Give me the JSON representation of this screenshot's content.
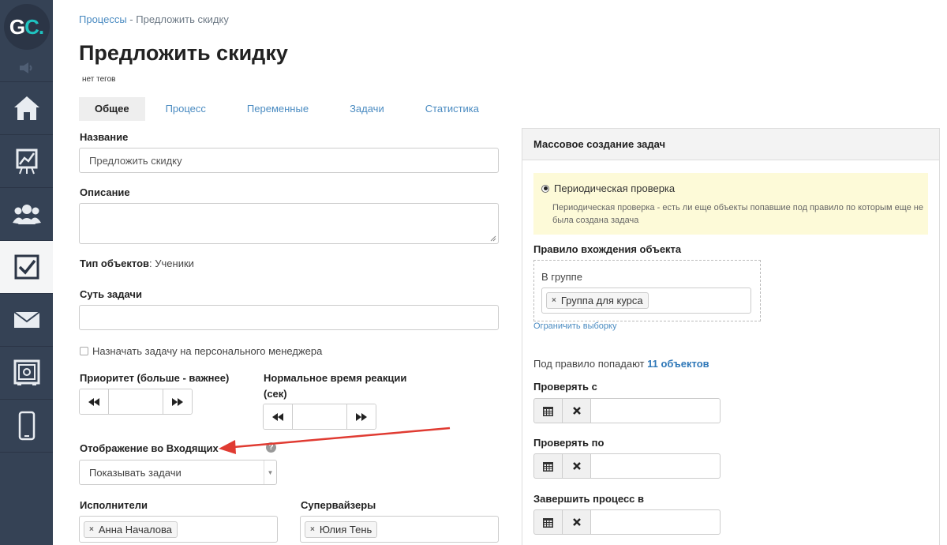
{
  "sidebar": {
    "logo": {
      "g": "G",
      "c": "C",
      "dot": "."
    },
    "items": [
      {
        "name": "home",
        "icon": "home-icon"
      },
      {
        "name": "stats",
        "icon": "chart-icon"
      },
      {
        "name": "users",
        "icon": "users-icon"
      },
      {
        "name": "tasks",
        "icon": "checkbox-icon",
        "active": true
      },
      {
        "name": "mail",
        "icon": "mail-icon"
      },
      {
        "name": "safe",
        "icon": "safe-icon"
      },
      {
        "name": "mobile",
        "icon": "phone-icon"
      }
    ]
  },
  "breadcrumb": {
    "root": "Процессы",
    "separator": " - ",
    "current": "Предложить скидку"
  },
  "page": {
    "title": "Предложить скидку",
    "tags": "нет тегов"
  },
  "tabs": [
    {
      "label": "Общее"
    },
    {
      "label": "Процесс"
    },
    {
      "label": "Переменные"
    },
    {
      "label": "Задачи"
    },
    {
      "label": "Статистика"
    }
  ],
  "form": {
    "name_label": "Название",
    "name_value": "Предложить скидку",
    "description_label": "Описание",
    "object_type_label": "Тип объектов",
    "object_type_value": ": Ученики",
    "essence_label": "Суть задачи",
    "personal_manager_label": "Назначать задачу на персонального менеджера",
    "priority_label": "Приоритет (больше - важнее)",
    "reaction_label_line1": "Нормальное время реакции",
    "reaction_label_line2": "(сек)",
    "inbox_label": "Отображение во Входящих",
    "inbox_help": "?",
    "inbox_select_value": "Показывать задачи",
    "executors_label": "Исполнители",
    "executors": [
      "Анна Началова"
    ],
    "supervisors_label": "Супервайзеры",
    "supervisors": [
      "Юлия Тень"
    ],
    "chip_remove": "×"
  },
  "panel": {
    "title": "Массовое создание задач",
    "mode_label": "Периодическая проверка",
    "mode_description": "Периодическая проверка - есть ли еще объекты попавшие под правило по которым еще не была создана задача",
    "rule_label": "Правило вхождения объекта",
    "group_label": "В группе",
    "group_chip": "Группа для курса",
    "limit_link": "Ограничить выборку",
    "count_prefix": "Под правило попадают ",
    "count_link": "11 объектов",
    "check_from_label": "Проверять с",
    "check_to_label": "Проверять по",
    "finish_label": "Завершить процесс в"
  },
  "colors": {
    "sidebar": "#354255",
    "link": "#4a8bc1",
    "accent": "#1fc3c0",
    "arrow": "#e03b32",
    "notice": "#fdfad8"
  }
}
